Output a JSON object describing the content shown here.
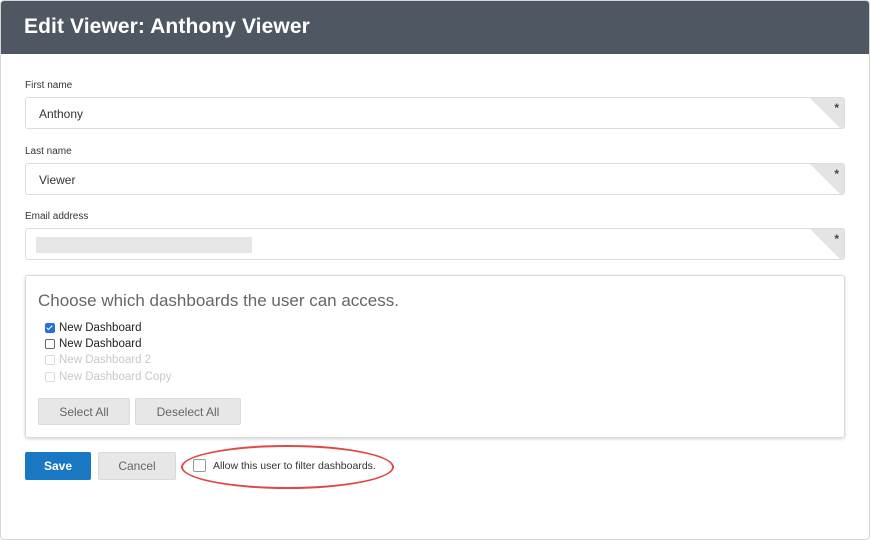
{
  "header": {
    "title": "Edit Viewer: Anthony Viewer"
  },
  "form": {
    "first_name": {
      "label": "First name",
      "value": "Anthony",
      "required_marker": "*"
    },
    "last_name": {
      "label": "Last name",
      "value": "Viewer",
      "required_marker": "*"
    },
    "email": {
      "label": "Email address",
      "value": "",
      "required_marker": "*"
    }
  },
  "access": {
    "heading": "Choose which dashboards the user can access.",
    "dashboards": [
      {
        "label": "New Dashboard",
        "checked": true,
        "disabled": false
      },
      {
        "label": "New Dashboard",
        "checked": false,
        "disabled": false
      },
      {
        "label": "New Dashboard 2",
        "checked": false,
        "disabled": true
      },
      {
        "label": "New Dashboard Copy",
        "checked": false,
        "disabled": true
      }
    ],
    "select_all_label": "Select All",
    "deselect_all_label": "Deselect All"
  },
  "actions": {
    "save_label": "Save",
    "cancel_label": "Cancel",
    "filter_option_label": "Allow this user to filter dashboards.",
    "filter_option_checked": false
  },
  "colors": {
    "header_bg": "#4f5862",
    "save_bg": "#1a78c2",
    "highlight": "#e04848",
    "checkbox_checked": "#2a6fd6"
  }
}
